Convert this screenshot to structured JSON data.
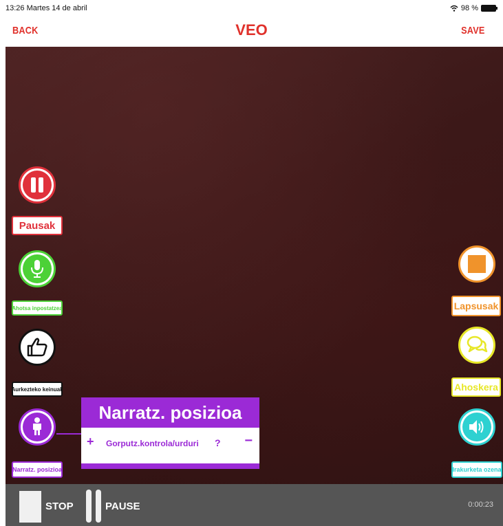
{
  "status_bar": {
    "time_date": "13:26  Martes 14 de abril",
    "battery": "98 %"
  },
  "nav": {
    "back": "BACK",
    "title": "VEO",
    "save": "SAVE"
  },
  "left_buttons": [
    {
      "label": "Pausak",
      "icon": "pause-icon",
      "color": "#e0313b"
    },
    {
      "label": "Ahotsa inpostatzea",
      "icon": "microphone-icon",
      "color": "#4cd137"
    },
    {
      "label": "Aurkezteko keinuak",
      "icon": "thumbs-up-icon",
      "color": "#111111"
    },
    {
      "label": "Narratz. posizioa",
      "icon": "person-icon",
      "color": "#9b2ad6"
    }
  ],
  "right_buttons": [
    {
      "label": "Lapsusak",
      "icon": "stop-square-icon",
      "color": "#f0932b"
    },
    {
      "label": "Ahoskera",
      "icon": "speech-bubble-icon",
      "color": "#e7e727"
    },
    {
      "label": "Irakurketa ozena",
      "icon": "speaker-icon",
      "color": "#2ed1d1"
    }
  ],
  "panel": {
    "title": "Narratz. posizioa",
    "plus": "+",
    "item": "Gorputz.kontrola/urduri",
    "help": "?",
    "minus": "−"
  },
  "toolbar": {
    "stop": "STOP",
    "pause": "PAUSE",
    "timer": "0:00:23"
  }
}
